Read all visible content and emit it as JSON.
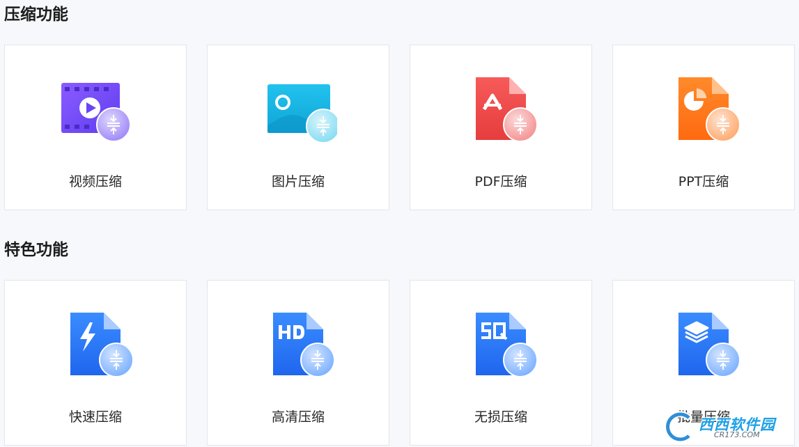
{
  "sections": [
    {
      "title": "压缩功能",
      "cards": [
        {
          "label": "视频压缩",
          "icon": "video-compress-icon",
          "color": "#7c4dff"
        },
        {
          "label": "图片压缩",
          "icon": "image-compress-icon",
          "color": "#1bb6e0"
        },
        {
          "label": "PDF压缩",
          "icon": "pdf-compress-icon",
          "color": "#ef4b4b"
        },
        {
          "label": "PPT压缩",
          "icon": "ppt-compress-icon",
          "color": "#ff7a1a"
        }
      ]
    },
    {
      "title": "特色功能",
      "cards": [
        {
          "label": "快速压缩",
          "icon": "fast-compress-icon",
          "color": "#2a78f5"
        },
        {
          "label": "高清压缩",
          "icon": "hd-compress-icon",
          "color": "#2a78f5"
        },
        {
          "label": "无损压缩",
          "icon": "lossless-compress-icon",
          "color": "#2a78f5"
        },
        {
          "label": "批量压缩",
          "icon": "batch-compress-icon",
          "color": "#2a78f5"
        }
      ]
    }
  ],
  "watermark": {
    "brand": "西西软件园",
    "url": "CR173.COM"
  }
}
